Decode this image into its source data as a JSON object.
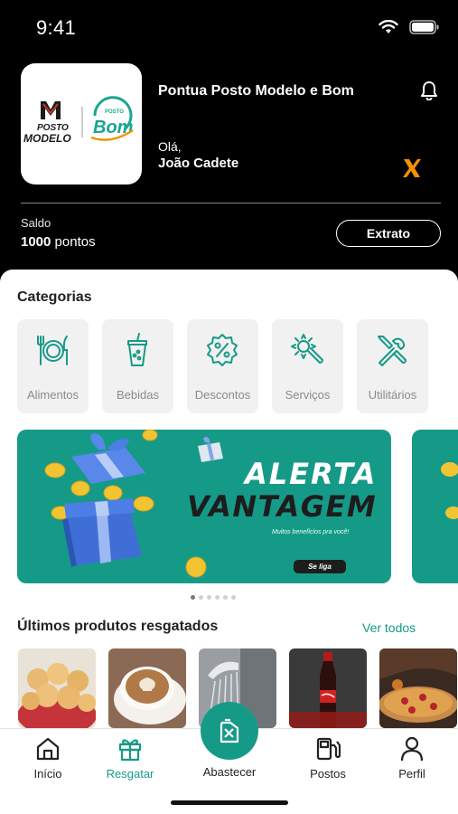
{
  "status_bar": {
    "time": "9:41"
  },
  "header": {
    "app_title": "Pontua Posto Modelo e Bom",
    "greeting": "Olá,",
    "user_name": "João Cadete",
    "logo": {
      "brand1_line1": "POSTO",
      "brand1_line2": "MODELO",
      "brand2_small": "POSTO",
      "brand2": "Bom"
    }
  },
  "balance": {
    "label": "Saldo",
    "amount": "1000",
    "unit": "pontos",
    "statement_button": "Extrato"
  },
  "categories": {
    "title": "Categorias",
    "items": [
      {
        "label": "Alimentos",
        "icon": "plate-cutlery-icon"
      },
      {
        "label": "Bebidas",
        "icon": "drink-cup-icon"
      },
      {
        "label": "Descontos",
        "icon": "discount-badge-icon"
      },
      {
        "label": "Serviços",
        "icon": "gear-wrench-icon"
      },
      {
        "label": "Utilitários",
        "icon": "tools-icon"
      }
    ]
  },
  "banner": {
    "title_line1": "ALERTA",
    "title_line2": "VANTAGEM",
    "subtitle": "Muitos benefícios pra você!",
    "button": "Se liga",
    "color": "#169a88"
  },
  "carousel": {
    "pages": 6,
    "active_index": 0
  },
  "products": {
    "title": "Últimos produtos resgatados",
    "see_all": "Ver todos",
    "items": [
      {
        "name": "pão de queijo"
      },
      {
        "name": "café"
      },
      {
        "name": "chuveiro"
      },
      {
        "name": "coca-cola"
      },
      {
        "name": "pizza"
      }
    ]
  },
  "bottom_nav": {
    "items": [
      {
        "label": "Início",
        "icon": "home-icon"
      },
      {
        "label": "Resgatar",
        "icon": "gift-icon",
        "active": true
      },
      {
        "label": "Abastecer",
        "icon": "fuel-can-icon"
      },
      {
        "label": "Postos",
        "icon": "gas-station-icon"
      },
      {
        "label": "Perfil",
        "icon": "user-icon"
      }
    ]
  },
  "colors": {
    "accent": "#169a88",
    "header_bg": "#000000",
    "secondary_accent": "#f39200"
  }
}
